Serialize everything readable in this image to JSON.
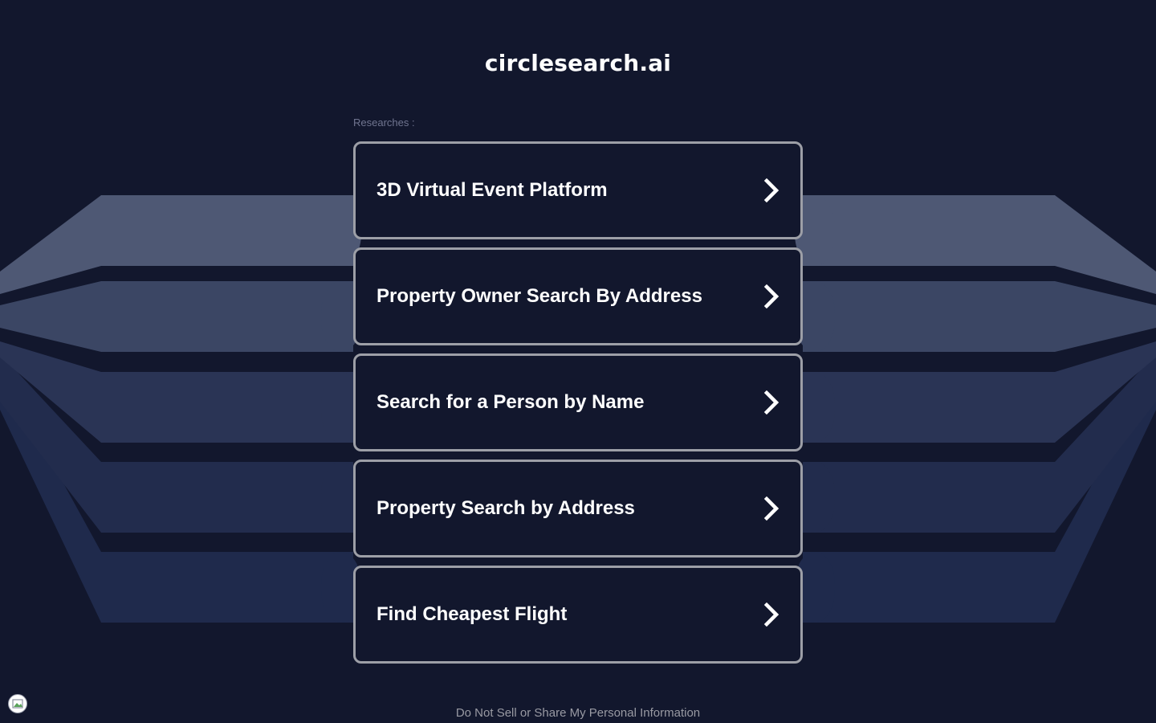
{
  "site": {
    "title": "circlesearch.ai"
  },
  "results_section": {
    "label": "Researches :",
    "items": [
      {
        "label": "3D Virtual Event Platform",
        "icon": "chevron-right-icon"
      },
      {
        "label": "Property Owner Search By Address",
        "icon": "chevron-right-icon"
      },
      {
        "label": "Search for a Person by Name",
        "icon": "chevron-right-icon"
      },
      {
        "label": "Property Search by Address",
        "icon": "chevron-right-icon"
      },
      {
        "label": "Find Cheapest Flight",
        "icon": "chevron-right-icon"
      }
    ]
  },
  "footer": {
    "privacy_link": "Do Not Sell or Share My Personal Information",
    "privacy_badge_icon": "privacy-settings-icon"
  },
  "colors": {
    "background": "#12172d",
    "card_border": "#9d9fa7",
    "text": "#ffffff",
    "muted_text": "#707590",
    "band_1": "#4e5874",
    "band_2": "#3b4664",
    "band_3": "#2a3455",
    "band_4": "#222c4d",
    "band_5": "#1f2a4c"
  }
}
